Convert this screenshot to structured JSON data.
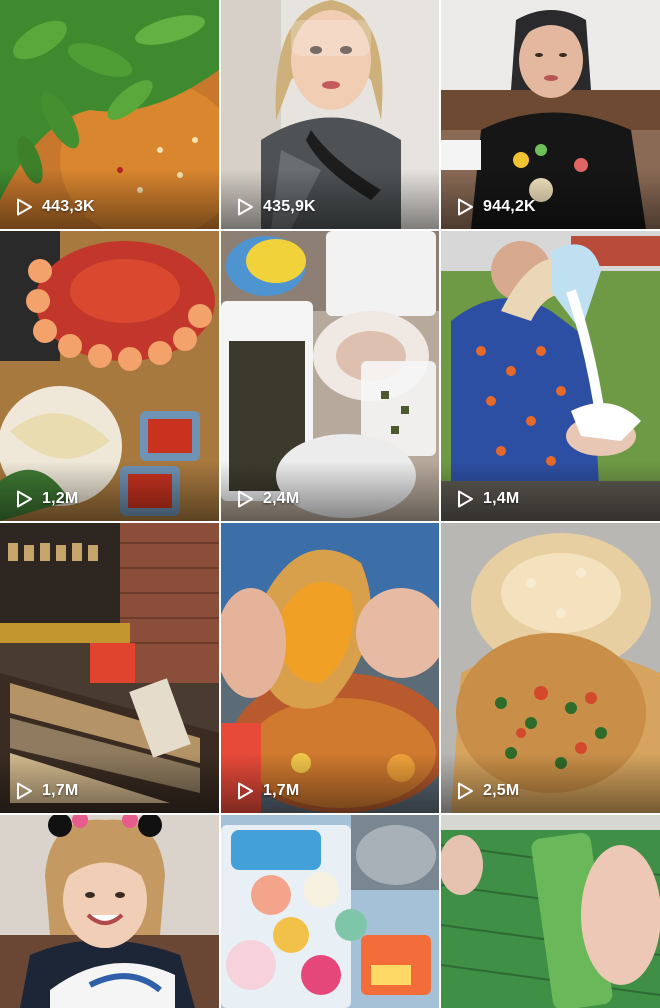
{
  "grid": {
    "columns": 3,
    "icon": "play-icon",
    "tiles": [
      {
        "views": "443,3K",
        "scene": "stir-fried green peppers in chili sauce"
      },
      {
        "views": "435,9K",
        "scene": "woman in salon cape with wet hair"
      },
      {
        "views": "944,2K",
        "scene": "woman in black shirt eating on bench"
      },
      {
        "views": "1,2M",
        "scene": "seafood hotpot with shrimp and crab"
      },
      {
        "views": "2,4M",
        "scene": "plastic containers of jelly drinks"
      },
      {
        "views": "1,4M",
        "scene": "woman in patterned shirt pouring slime"
      },
      {
        "views": "1,7M",
        "scene": "dried food shop shelves"
      },
      {
        "views": "1,7M",
        "scene": "hand holding crab shell with roe"
      },
      {
        "views": "2,5M",
        "scene": "crispy rice cake with pork floss"
      },
      {
        "views": "",
        "scene": "smiling woman holding sneaker"
      },
      {
        "views": "",
        "scene": "colorful candy toy packages"
      },
      {
        "views": "",
        "scene": "hands holding green pandan leaf"
      }
    ]
  },
  "colors": {
    "background": "#ffffff",
    "overlay_text": "#ffffff"
  }
}
